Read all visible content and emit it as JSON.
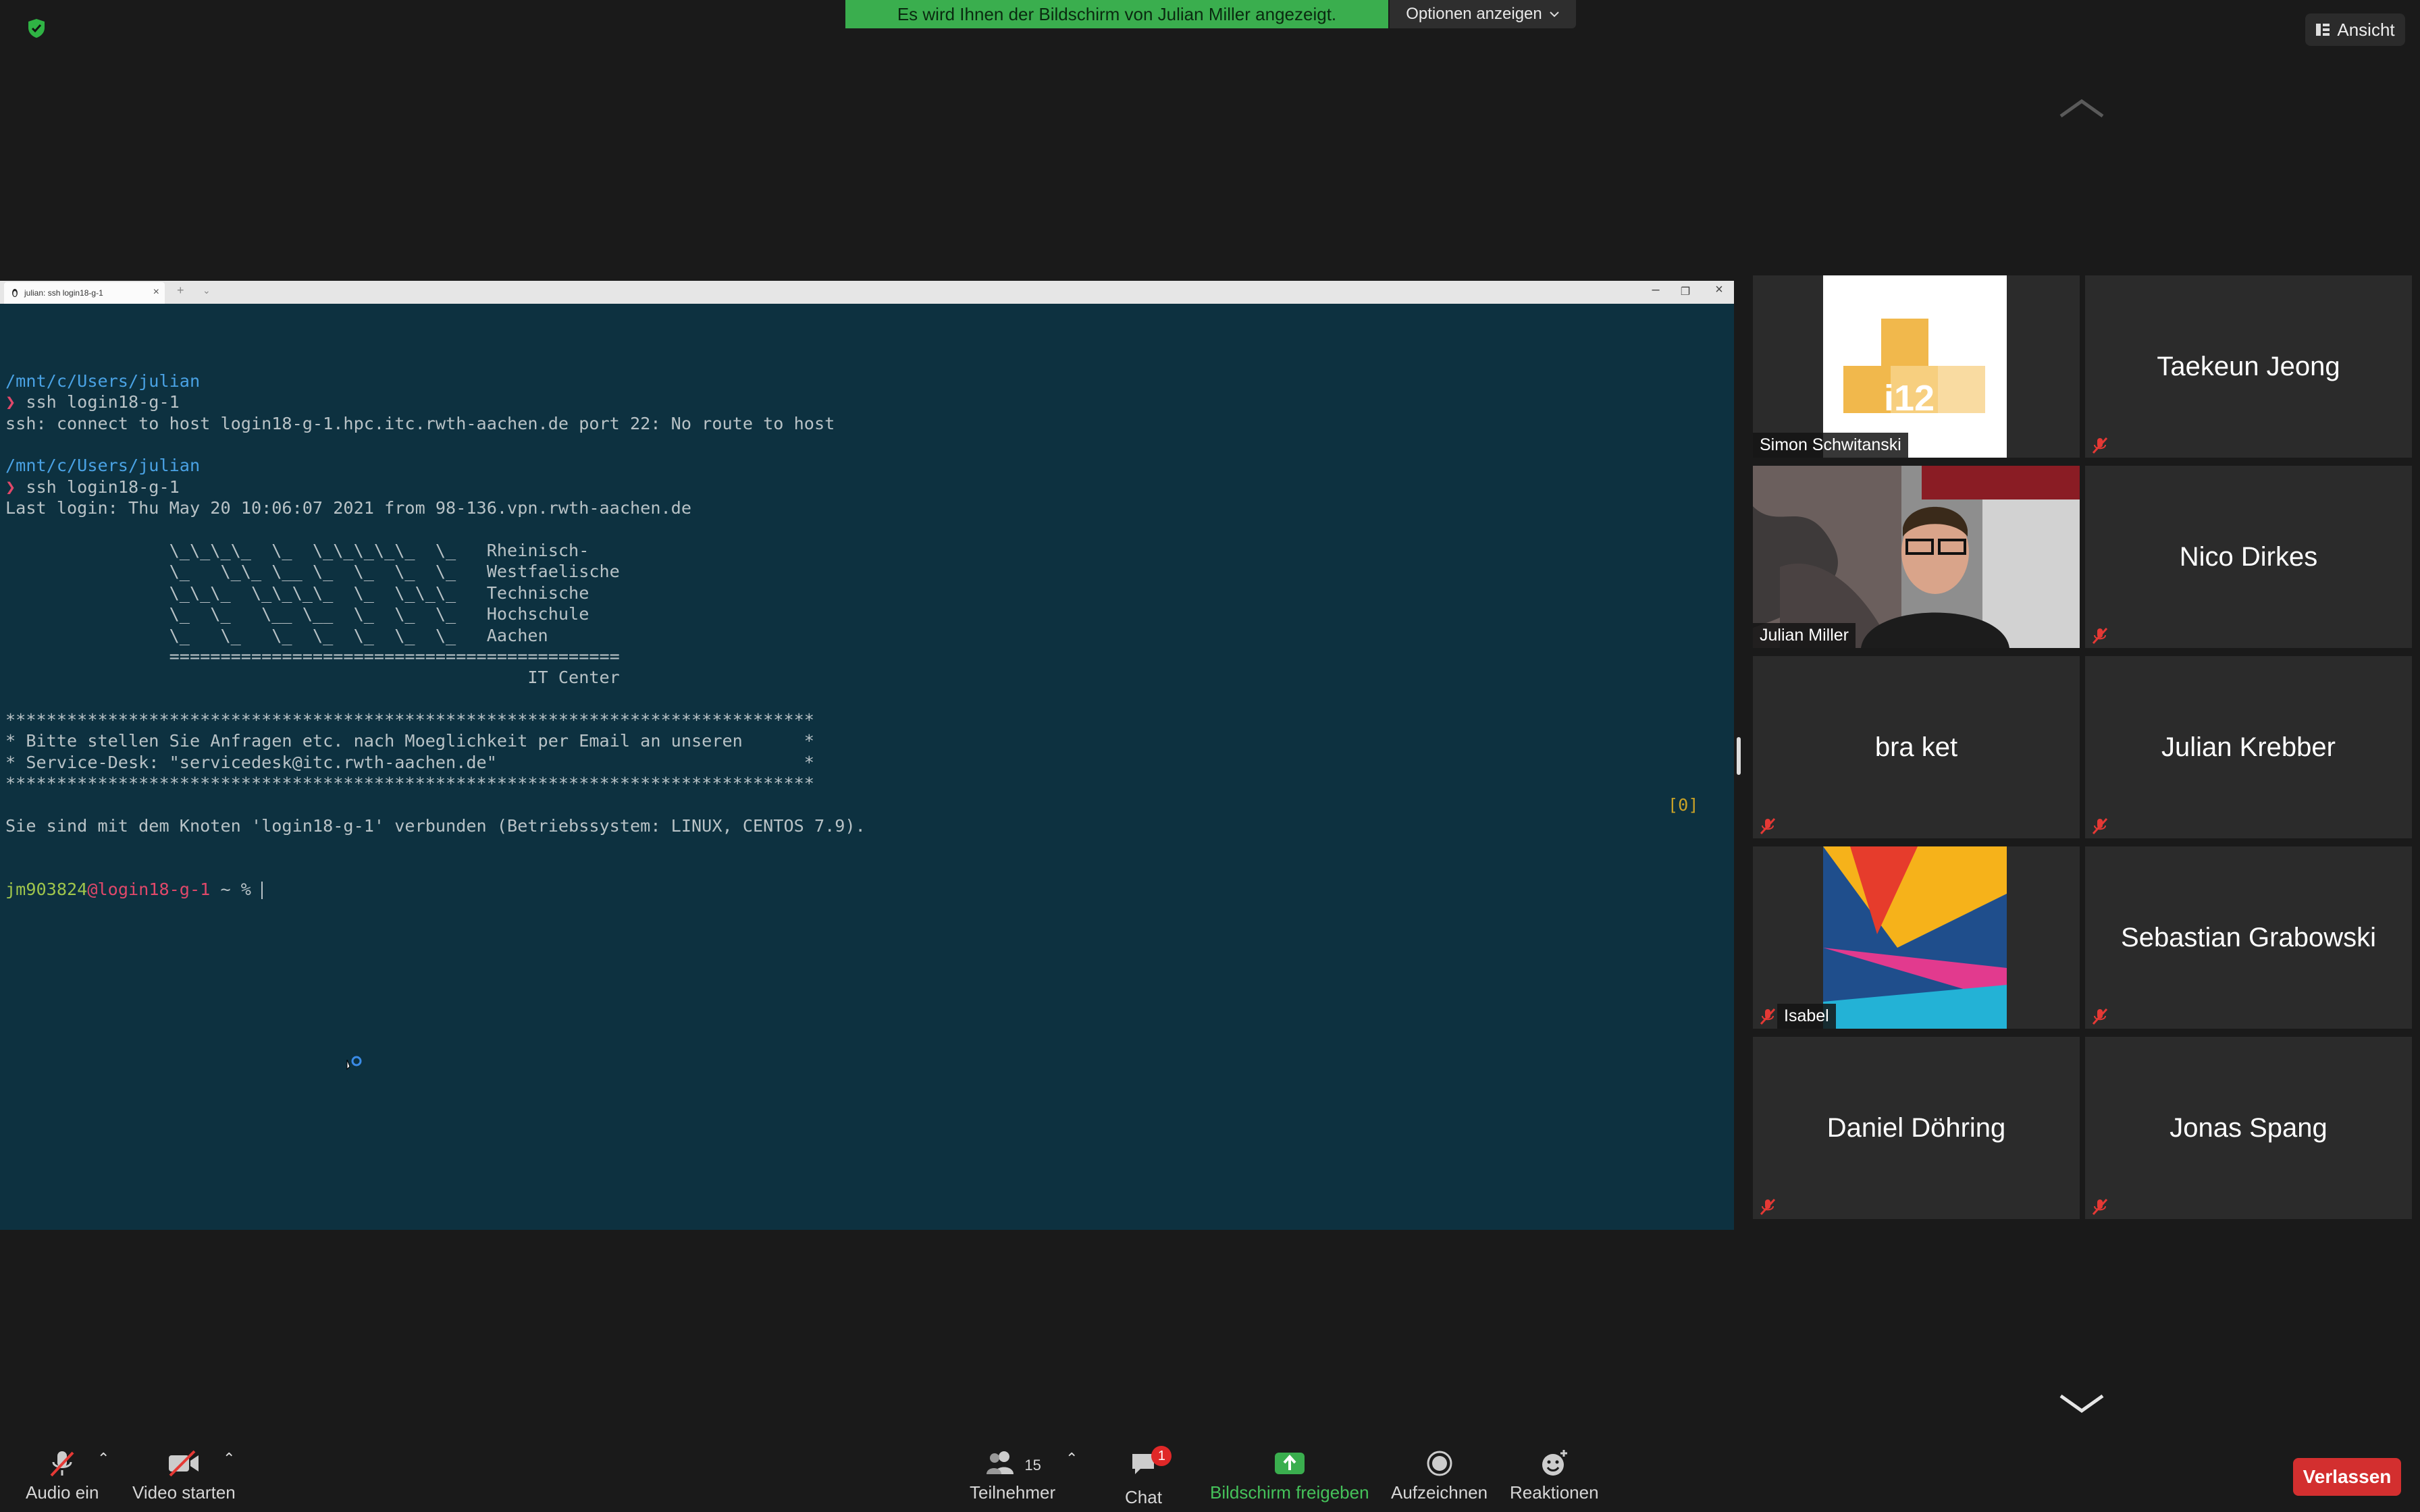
{
  "top": {
    "share_banner": "Es wird Ihnen der Bildschirm von Julian Miller angezeigt.",
    "options_label": "Optionen anzeigen",
    "view_label": "Ansicht"
  },
  "terminal": {
    "tab_title": "julian: ssh login18-g-1",
    "lines": [
      {
        "t": "/mnt/c/Users/julian",
        "c": "path"
      },
      {
        "t": "❯ ssh login18-g-1",
        "c": "cmd"
      },
      {
        "t": "ssh: connect to host login18-g-1.hpc.itc.rwth-aachen.de port 22: No route to host",
        "c": ""
      },
      {
        "t": "",
        "c": ""
      },
      {
        "t": "/mnt/c/Users/julian",
        "c": "path"
      },
      {
        "t": "❯ ssh login18-g-1",
        "c": "cmd"
      },
      {
        "t": "Last login: Thu May 20 10:06:07 2021 from 98-136.vpn.rwth-aachen.de",
        "c": ""
      },
      {
        "t": "",
        "c": ""
      },
      {
        "t": "                \\_\\_\\_\\_  \\_  \\_\\_\\_\\_\\_  \\_   Rheinisch-",
        "c": ""
      },
      {
        "t": "                \\_   \\_\\_ \\__ \\_  \\_  \\_  \\_   Westfaelische",
        "c": ""
      },
      {
        "t": "                \\_\\_\\_  \\_\\_\\_\\_  \\_  \\_\\_\\_   Technische",
        "c": ""
      },
      {
        "t": "                \\_  \\_   \\__ \\__  \\_  \\_  \\_   Hochschule",
        "c": ""
      },
      {
        "t": "                \\_   \\_   \\_  \\_  \\_  \\_  \\_   Aachen",
        "c": ""
      },
      {
        "t": "                ============================================",
        "c": ""
      },
      {
        "t": "                                                   IT Center",
        "c": ""
      },
      {
        "t": "",
        "c": ""
      },
      {
        "t": "*******************************************************************************",
        "c": ""
      },
      {
        "t": "* Bitte stellen Sie Anfragen etc. nach Moeglichkeit per Email an unseren      *",
        "c": ""
      },
      {
        "t": "* Service-Desk: \"servicedesk@itc.rwth-aachen.de\"                              *",
        "c": ""
      },
      {
        "t": "*******************************************************************************",
        "c": ""
      },
      {
        "t": "",
        "c": ""
      },
      {
        "t": "Sie sind mit dem Knoten 'login18-g-1' verbunden (Betriebssystem: LINUX, CENTOS 7.9).",
        "c": ""
      }
    ],
    "prompt_user": "jm903824",
    "prompt_host": "@login18-g-1",
    "prompt_tail": " ~ % ",
    "counter": "[0]"
  },
  "participants": [
    {
      "name": "Simon Schwitanski",
      "kind": "avatar-i12",
      "muted": false
    },
    {
      "name": "Taekeun Jeong",
      "kind": "text",
      "muted": true
    },
    {
      "name": "Julian Miller",
      "kind": "video",
      "muted": false,
      "active": true
    },
    {
      "name": "Nico Dirkes",
      "kind": "text",
      "muted": true
    },
    {
      "name": "bra ket",
      "kind": "text",
      "muted": true
    },
    {
      "name": "Julian Krebber",
      "kind": "text",
      "muted": true
    },
    {
      "name": "Isabel",
      "kind": "avatar-abstract",
      "muted": true
    },
    {
      "name": "Sebastian Grabowski",
      "kind": "text",
      "muted": true
    },
    {
      "name": "Daniel Döhring",
      "kind": "text",
      "muted": true
    },
    {
      "name": "Jonas Spang",
      "kind": "text",
      "muted": true
    }
  ],
  "avatar_text": "i12",
  "toolbar": {
    "audio": "Audio ein",
    "video": "Video starten",
    "participants": "Teilnehmer",
    "participant_count": "15",
    "chat": "Chat",
    "chat_badge": "1",
    "share": "Bildschirm freigeben",
    "record": "Aufzeichnen",
    "reactions": "Reaktionen",
    "leave": "Verlassen"
  },
  "colors": {
    "share_green": "#3aae4e",
    "terminal_bg": "#0d3140",
    "leave_red": "#d32f2f",
    "active_border": "#e9e58c"
  }
}
